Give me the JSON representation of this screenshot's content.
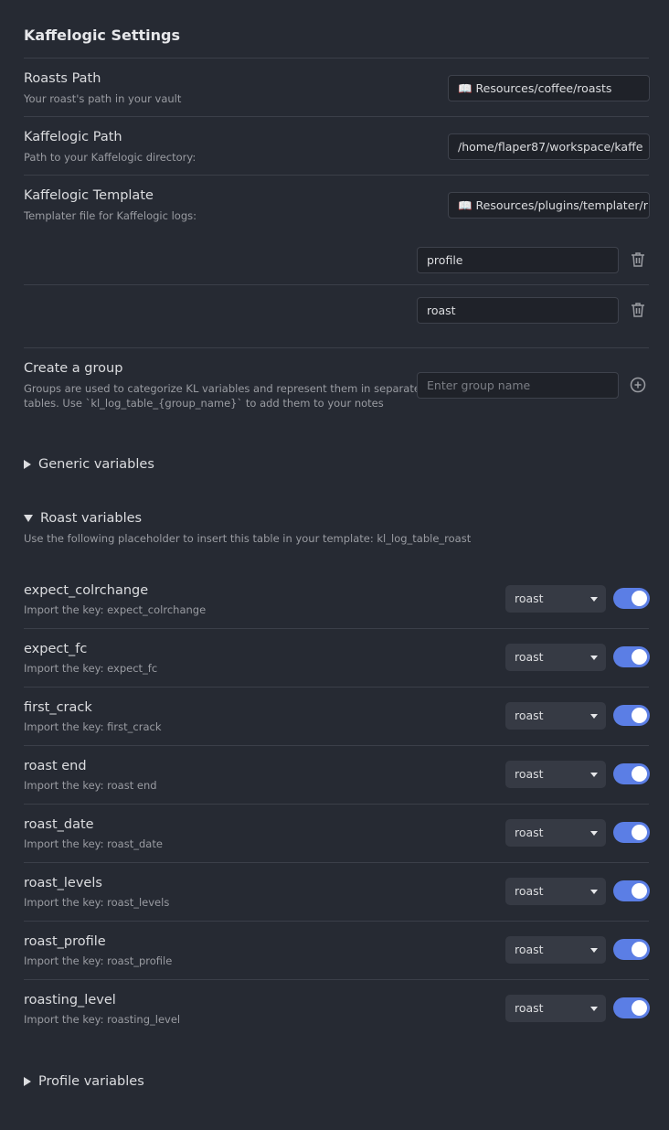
{
  "title": "Kaffelogic Settings",
  "settings": [
    {
      "name": "Roasts Path",
      "desc": "Your roast's path in your vault",
      "value": "📖 Resources/coffee/roasts"
    },
    {
      "name": "Kaffelogic Path",
      "desc": "Path to your Kaffelogic directory:",
      "value": "/home/flaper87/workspace/kaffe"
    },
    {
      "name": "Kaffelogic Template",
      "desc": "Templater file for Kaffelogic logs:",
      "value": "📖 Resources/plugins/templater/r"
    }
  ],
  "groups": [
    "profile",
    "roast"
  ],
  "create_group": {
    "name": "Create a group",
    "desc_line1": "Groups are used to categorize KL variables and represent them in separate",
    "desc_line2": "tables. Use `kl_log_table_{group_name}` to add them to your notes",
    "placeholder": "Enter group name"
  },
  "sections": {
    "generic": "Generic variables",
    "roast": "Roast variables",
    "roast_desc": "Use the following placeholder to insert this table in your template: kl_log_table_roast",
    "profile": "Profile variables"
  },
  "variables": [
    {
      "name": "expect_colrchange",
      "desc": "Import the key: expect_colrchange",
      "group": "roast",
      "enabled": true
    },
    {
      "name": "expect_fc",
      "desc": "Import the key: expect_fc",
      "group": "roast",
      "enabled": true
    },
    {
      "name": "first_crack",
      "desc": "Import the key: first_crack",
      "group": "roast",
      "enabled": true
    },
    {
      "name": "roast end",
      "desc": "Import the key: roast end",
      "group": "roast",
      "enabled": true
    },
    {
      "name": "roast_date",
      "desc": "Import the key: roast_date",
      "group": "roast",
      "enabled": true
    },
    {
      "name": "roast_levels",
      "desc": "Import the key: roast_levels",
      "group": "roast",
      "enabled": true
    },
    {
      "name": "roast_profile",
      "desc": "Import the key: roast_profile",
      "group": "roast",
      "enabled": true
    },
    {
      "name": "roasting_level",
      "desc": "Import the key: roasting_level",
      "group": "roast",
      "enabled": true
    }
  ],
  "colors": {
    "background": "#262a33",
    "accent": "#5b7ee5",
    "divider": "#3b3f49"
  }
}
